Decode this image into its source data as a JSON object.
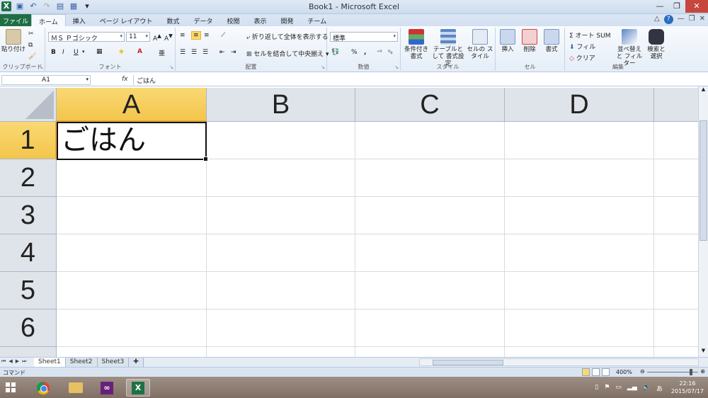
{
  "window": {
    "title": "Book1 - Microsoft Excel",
    "qat_icons": [
      "excel-logo-icon",
      "save-icon",
      "undo-icon",
      "redo-icon",
      "print-preview-icon",
      "form-icon",
      "customize-qat-icon"
    ]
  },
  "tabs": [
    {
      "label": "ファイル"
    },
    {
      "label": "ホーム"
    },
    {
      "label": "挿入"
    },
    {
      "label": "ページ レイアウト"
    },
    {
      "label": "数式"
    },
    {
      "label": "データ"
    },
    {
      "label": "校閲"
    },
    {
      "label": "表示"
    },
    {
      "label": "開発"
    },
    {
      "label": "チーム"
    }
  ],
  "ribbon": {
    "clipboard": {
      "paste": "貼り付け",
      "label": "クリップボード"
    },
    "font": {
      "name": "ＭＳ Ｐゴシック",
      "size": "11",
      "label": "フォント",
      "bold": "B",
      "italic": "I",
      "underline": "U"
    },
    "alignment": {
      "wrap": "折り返して全体を表示する",
      "merge": "セルを結合して中央揃え",
      "label": "配置"
    },
    "number": {
      "format": "標準",
      "label": "数値",
      "percent": "%",
      "comma": ","
    },
    "styles": {
      "conditional": "条件付き 書式",
      "table": "テーブルとして 書式設定",
      "cell": "セルの スタイル",
      "label": "スタイル"
    },
    "cells": {
      "insert": "挿入",
      "delete": "削除",
      "format": "書式",
      "label": "セル"
    },
    "editing": {
      "autosum": "Σ オート SUM",
      "fill": "フィル",
      "clear": "クリア",
      "sort": "並べ替えと フィルター",
      "find": "検索と 選択",
      "label": "編集"
    }
  },
  "formula_bar": {
    "name_box": "A1",
    "fx": "fx",
    "content": "ごはん"
  },
  "grid": {
    "columns": [
      "A",
      "B",
      "C",
      "D"
    ],
    "rows": [
      "1",
      "2",
      "3",
      "4",
      "5",
      "6"
    ],
    "cells": {
      "A1": "ごはん"
    }
  },
  "sheets": [
    {
      "name": "Sheet1"
    },
    {
      "name": "Sheet2"
    },
    {
      "name": "Sheet3"
    }
  ],
  "status": {
    "mode": "コマンド",
    "zoom": "400%",
    "zoom_level": 400
  },
  "taskbar": {
    "time": "22:16",
    "date": "2015/07/17",
    "ime": "あ"
  }
}
